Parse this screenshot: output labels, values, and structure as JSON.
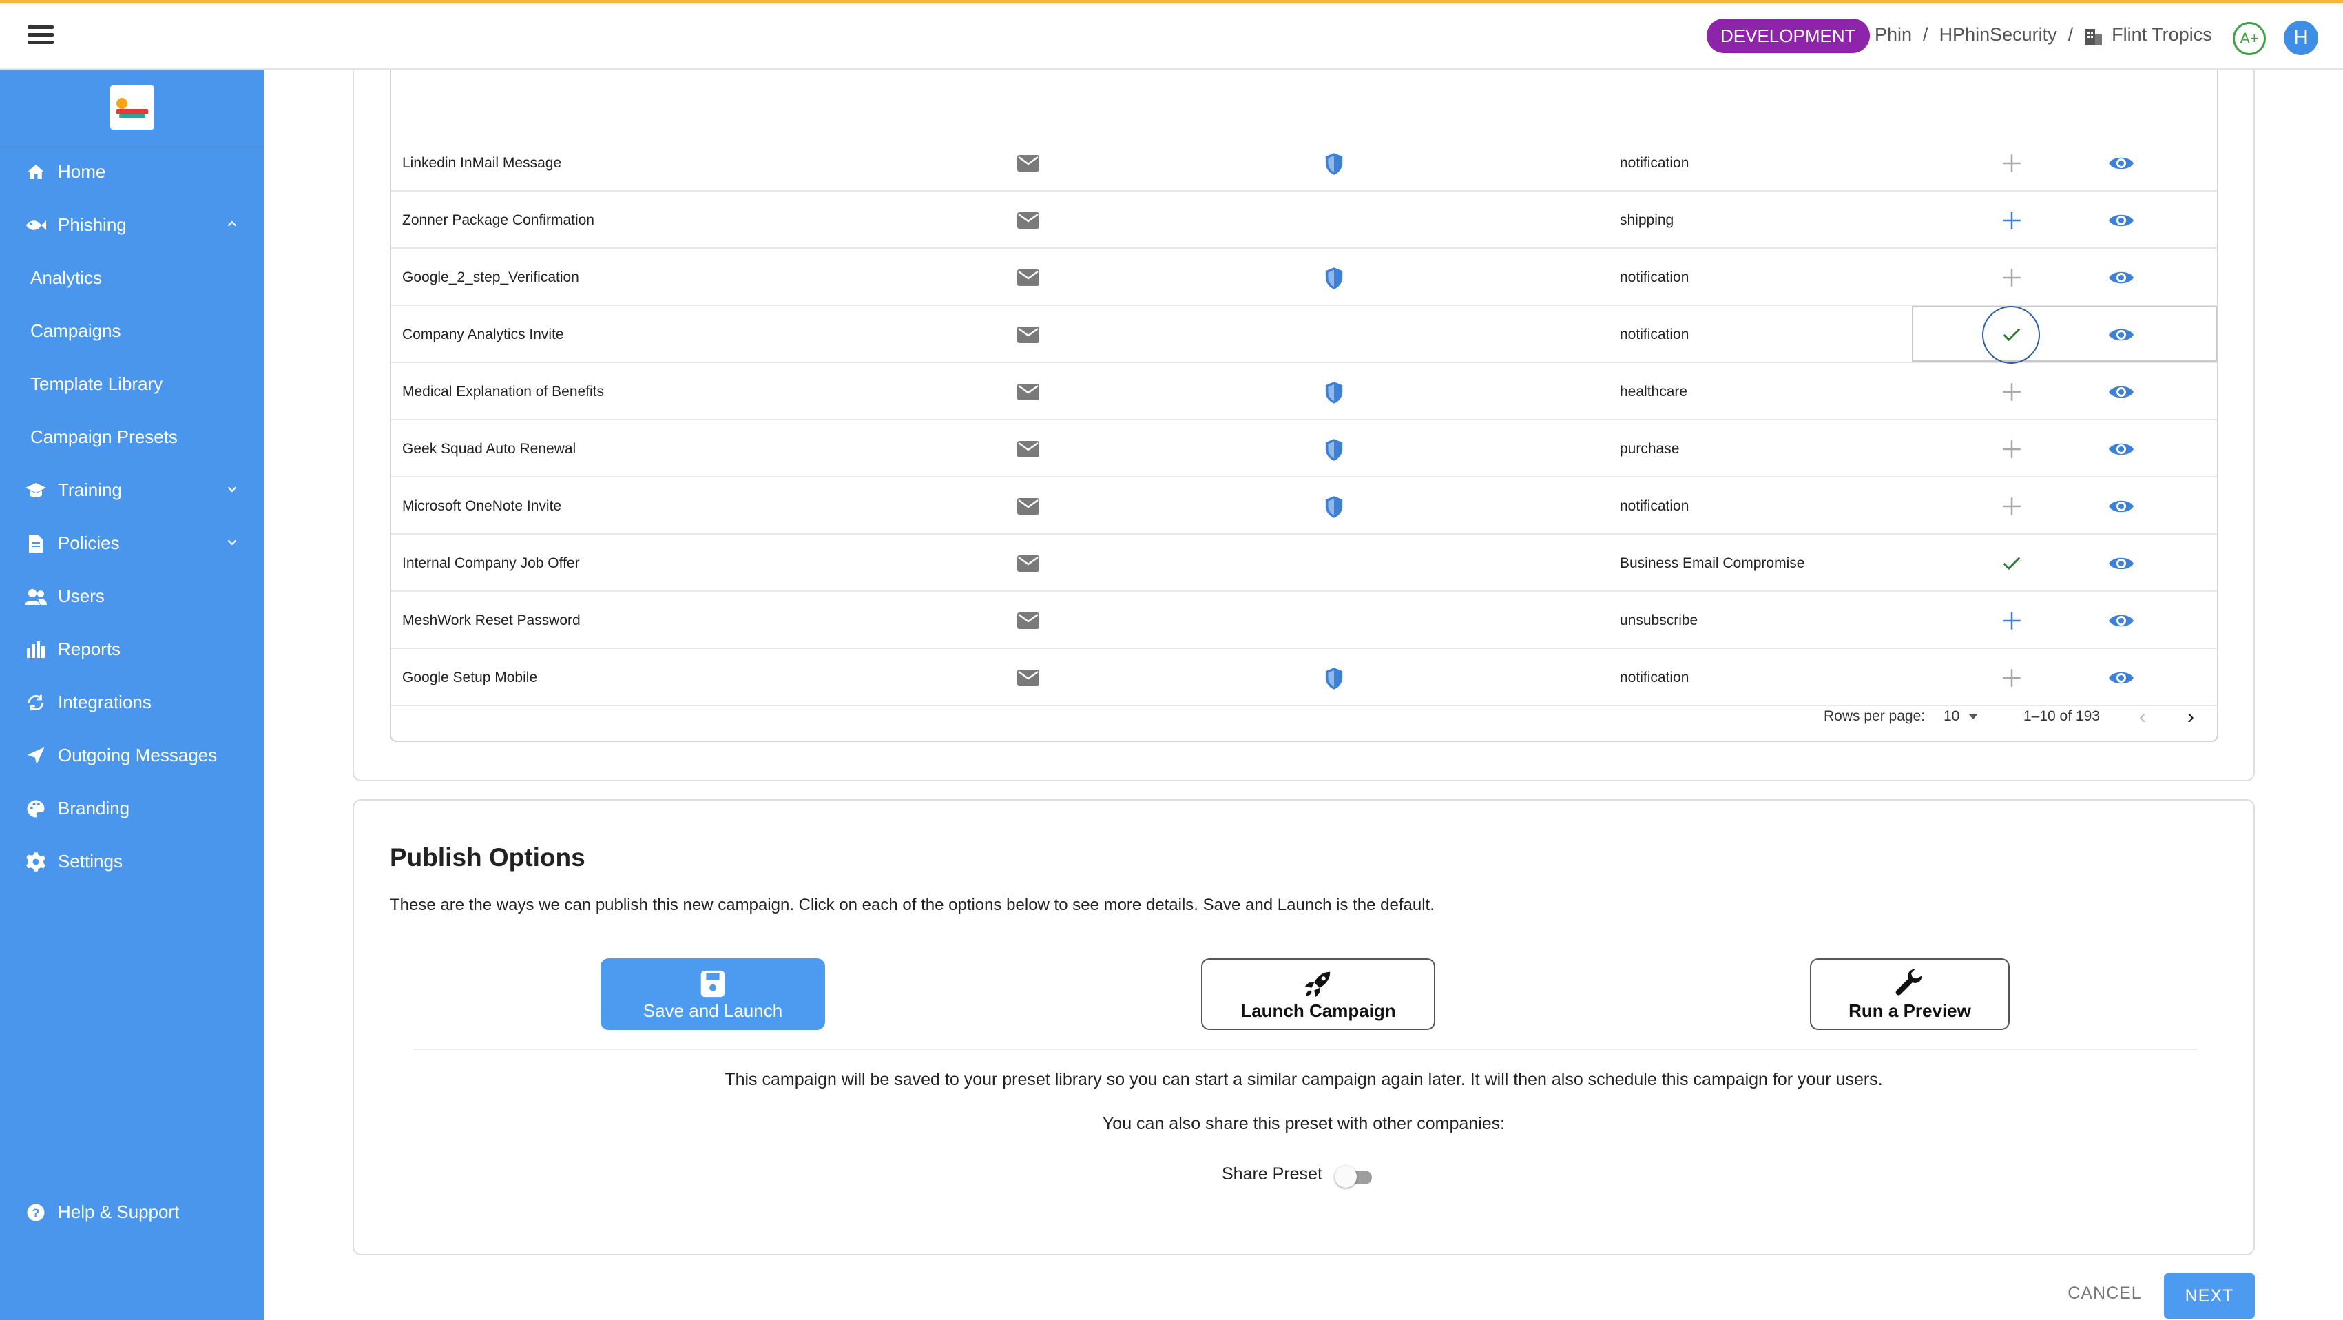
{
  "header": {
    "environment": "DEVELOPMENT",
    "breadcrumb": [
      "Phin",
      "HPhinSecurity",
      "Flint Tropics"
    ],
    "separator": "/",
    "grade": "A+",
    "avatar_letter": "H"
  },
  "sidebar": {
    "items": [
      {
        "label": "Home",
        "icon": "home-icon"
      },
      {
        "label": "Phishing",
        "icon": "phishing-icon",
        "expanded": true
      },
      {
        "label": "Analytics"
      },
      {
        "label": "Campaigns"
      },
      {
        "label": "Template Library"
      },
      {
        "label": "Campaign Presets"
      },
      {
        "label": "Training",
        "icon": "training-icon"
      },
      {
        "label": "Policies",
        "icon": "policies-icon"
      },
      {
        "label": "Users",
        "icon": "users-icon"
      },
      {
        "label": "Reports",
        "icon": "reports-icon"
      },
      {
        "label": "Integrations",
        "icon": "integrations-icon"
      },
      {
        "label": "Outgoing Messages",
        "icon": "send-icon"
      },
      {
        "label": "Branding",
        "icon": "palette-icon"
      },
      {
        "label": "Settings",
        "icon": "gear-icon"
      }
    ],
    "help_label": "Help & Support"
  },
  "templates": {
    "rows": [
      {
        "name": "Linkedin InMail Message",
        "shield": true,
        "tag": "notification",
        "state": "add-faint"
      },
      {
        "name": "Zonner Package Confirmation",
        "shield": false,
        "tag": "shipping",
        "state": "add"
      },
      {
        "name": "Google_2_step_Verification",
        "shield": true,
        "tag": "notification",
        "state": "add-faint"
      },
      {
        "name": "Company Analytics Invite",
        "shield": false,
        "tag": "notification",
        "state": "checked-focused"
      },
      {
        "name": "Medical Explanation of Benefits",
        "shield": true,
        "tag": "healthcare",
        "state": "add-faint"
      },
      {
        "name": "Geek Squad Auto Renewal",
        "shield": true,
        "tag": "purchase",
        "state": "add-faint"
      },
      {
        "name": "Microsoft OneNote Invite",
        "shield": true,
        "tag": "notification",
        "state": "add-faint"
      },
      {
        "name": "Internal Company Job Offer",
        "shield": false,
        "tag": "Business Email Compromise",
        "state": "checked"
      },
      {
        "name": "MeshWork Reset Password",
        "shield": false,
        "tag": "unsubscribe",
        "state": "add"
      },
      {
        "name": "Google Setup Mobile",
        "shield": true,
        "tag": "notification",
        "state": "add-faint"
      }
    ],
    "pagination": {
      "rows_per_page_label": "Rows per page:",
      "rows_per_page": "10",
      "range": "1–10 of 193"
    }
  },
  "publish": {
    "title": "Publish Options",
    "description": "These are the ways we can publish this new campaign. Click on each of the options below to see more details. Save and Launch is the default.",
    "options": [
      {
        "label": "Save and Launch",
        "icon": "save-icon",
        "selected": true
      },
      {
        "label": "Launch Campaign",
        "icon": "rocket-icon",
        "selected": false
      },
      {
        "label": "Run a Preview",
        "icon": "wrench-icon",
        "selected": false
      }
    ],
    "info_line1": "This campaign will be saved to your preset library so you can start a similar campaign again later. It will then also schedule this campaign for your users.",
    "info_line2": "You can also share this preset with other companies:",
    "share_label": "Share Preset",
    "share_enabled": false
  },
  "footer": {
    "cancel_label": "CANCEL",
    "next_label": "NEXT"
  },
  "colors": {
    "sidebar": "#4a96ec",
    "accent": "#4d9bf0",
    "environment_badge": "#8e24aa",
    "check": "#2e7d32",
    "top_stripe": "#f5b63c"
  }
}
